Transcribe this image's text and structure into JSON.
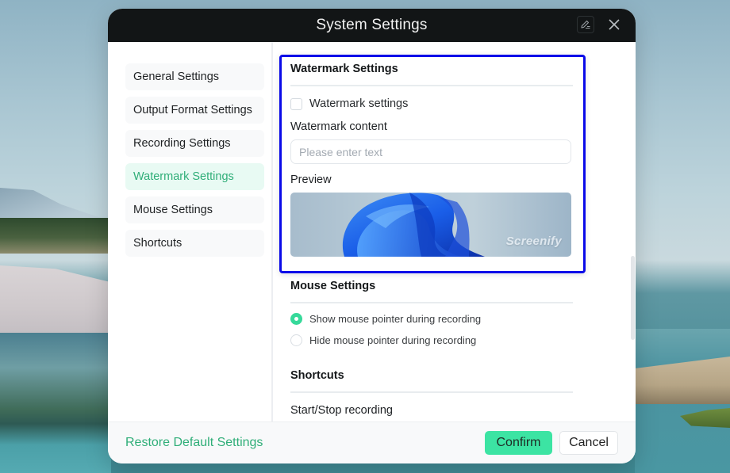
{
  "window": {
    "title": "System Settings",
    "icons": {
      "edit": "edit-pen-icon",
      "close": "close-icon"
    }
  },
  "sidebar": {
    "items": [
      {
        "label": "General Settings",
        "active": false
      },
      {
        "label": "Output Format Settings",
        "active": false
      },
      {
        "label": "Recording Settings",
        "active": false
      },
      {
        "label": "Watermark Settings",
        "active": true
      },
      {
        "label": "Mouse Settings",
        "active": false
      },
      {
        "label": "Shortcuts",
        "active": false
      }
    ]
  },
  "watermark": {
    "title": "Watermark Settings",
    "checkbox_label": "Watermark settings",
    "checkbox_checked": false,
    "content_label": "Watermark content",
    "content_value": "",
    "content_placeholder": "Please enter text",
    "preview_label": "Preview",
    "preview_watermark": "Screenify"
  },
  "mouse": {
    "title": "Mouse Settings",
    "options": [
      {
        "label": "Show mouse pointer during recording",
        "selected": true
      },
      {
        "label": "Hide mouse pointer during recording",
        "selected": false
      }
    ]
  },
  "shortcuts": {
    "title": "Shortcuts",
    "items": [
      "Start/Stop recording"
    ]
  },
  "footer": {
    "restore_label": "Restore Default Settings",
    "confirm_label": "Confirm",
    "cancel_label": "Cancel"
  },
  "colors": {
    "accent": "#2fae78",
    "confirm_bg": "#3ce4a3",
    "titlebar_bg": "#121516",
    "focus_outline": "#0a0ae8",
    "active_nav_bg": "#e8faf3"
  }
}
